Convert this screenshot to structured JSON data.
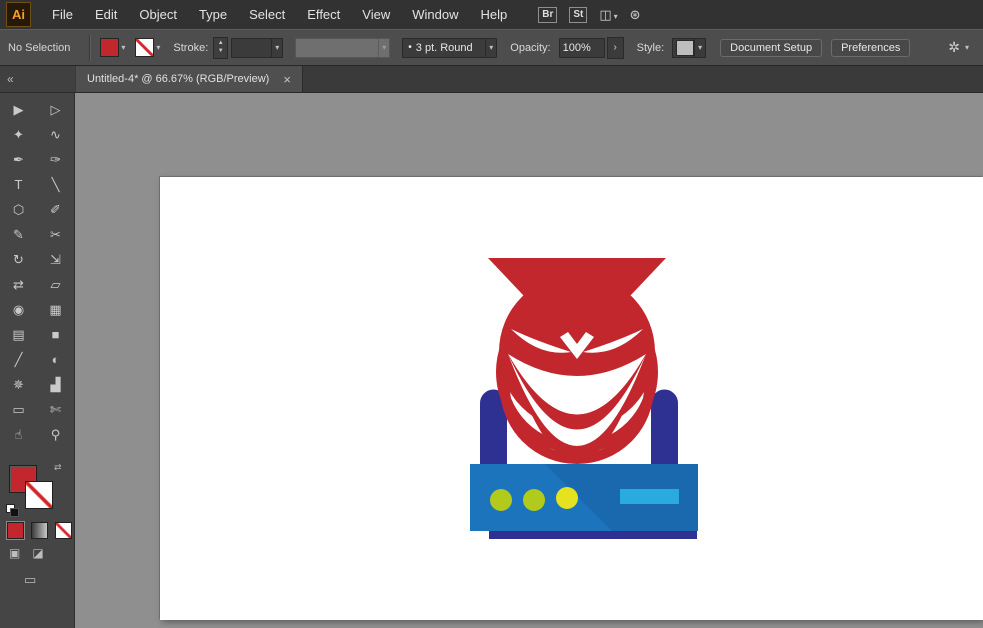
{
  "app": {
    "logo_text": "Ai"
  },
  "menubar": {
    "items": [
      "File",
      "Edit",
      "Object",
      "Type",
      "Select",
      "Effect",
      "View",
      "Window",
      "Help"
    ],
    "bridge_badge": "Br",
    "stock_badge": "St",
    "arrange_icon_glyph": "◫",
    "touch_icon_glyph": "⊛",
    "caret": "▾"
  },
  "controlbar": {
    "selection_status": "No Selection",
    "stroke_label": "Stroke:",
    "stepper_up": "▲",
    "stepper_down": "▼",
    "brush_bullet": "•",
    "brush_value": "3 pt. Round",
    "opacity_label": "Opacity:",
    "opacity_value": "100%",
    "opacity_arrow": "›",
    "style_label": "Style:",
    "document_setup_button": "Document Setup",
    "preferences_button": "Preferences",
    "right_icon_glyph": "✲",
    "caret": "▾"
  },
  "tabbar": {
    "collapse_glyph": "«",
    "tab_title": "Untitled-4* @ 66.67% (RGB/Preview)",
    "close_glyph": "×"
  },
  "toolbar": {
    "tools": [
      {
        "name": "selection-tool",
        "glyph": "▶"
      },
      {
        "name": "direct-selection-tool",
        "glyph": "▷"
      },
      {
        "name": "magic-wand-tool",
        "glyph": "✦"
      },
      {
        "name": "lasso-tool",
        "glyph": "∿"
      },
      {
        "name": "pen-tool",
        "glyph": "✒"
      },
      {
        "name": "curvature-tool",
        "glyph": "✑"
      },
      {
        "name": "type-tool",
        "glyph": "T"
      },
      {
        "name": "line-segment-tool",
        "glyph": "╲"
      },
      {
        "name": "shape-tool",
        "glyph": "⬡"
      },
      {
        "name": "paintbrush-tool",
        "glyph": "✐"
      },
      {
        "name": "shaper-tool",
        "glyph": "✎"
      },
      {
        "name": "scissors-tool",
        "glyph": "✂"
      },
      {
        "name": "rotate-tool",
        "glyph": "↻"
      },
      {
        "name": "scale-tool",
        "glyph": "⇲"
      },
      {
        "name": "width-tool",
        "glyph": "⇄"
      },
      {
        "name": "free-transform-tool",
        "glyph": "▱"
      },
      {
        "name": "shape-builder-tool",
        "glyph": "◉"
      },
      {
        "name": "perspective-grid-tool",
        "glyph": "▦"
      },
      {
        "name": "mesh-tool",
        "glyph": "▤"
      },
      {
        "name": "gradient-tool",
        "glyph": "■"
      },
      {
        "name": "eyedropper-tool",
        "glyph": "╱"
      },
      {
        "name": "blend-tool",
        "glyph": "◐"
      },
      {
        "name": "symbol-sprayer-tool",
        "glyph": "✵"
      },
      {
        "name": "column-graph-tool",
        "glyph": "▟"
      },
      {
        "name": "artboard-tool",
        "glyph": "▭"
      },
      {
        "name": "slice-tool",
        "glyph": "✄"
      },
      {
        "name": "hand-tool",
        "glyph": "☝"
      },
      {
        "name": "zoom-tool",
        "glyph": "⚲"
      }
    ],
    "swap_glyph": "⇄",
    "draw_normal_glyph": "▣",
    "draw_behind_glyph": "◪",
    "screen_mode_glyph": "▭"
  },
  "artwork": {
    "colors": {
      "red": "#C1272D",
      "navy": "#2E3192",
      "blue": "#1C75BC",
      "blue_shade": "#1A69AE",
      "light_blue": "#29ABE2",
      "green": "#B2CA1C",
      "yellow": "#E7E21F",
      "white": "#FFFFFF"
    }
  }
}
